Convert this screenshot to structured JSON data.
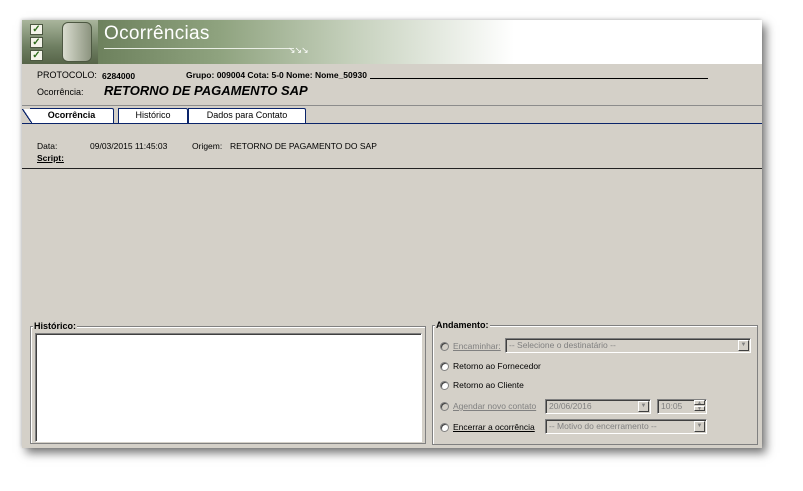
{
  "header": {
    "title": "Ocorrências",
    "arrows": "↘↘↘"
  },
  "protocol": {
    "label": "PROTOCOLO:",
    "value": "6284000",
    "group_info": "Grupo: 009004 Cota: 5-0 Nome: Nome_50930",
    "occurrence_label": "Ocorrência:",
    "occurrence_title": "RETORNO DE PAGAMENTO SAP"
  },
  "tabs": [
    {
      "label": "Ocorrência",
      "active": true
    },
    {
      "label": "Histórico",
      "active": false
    },
    {
      "label": "Dados para Contato",
      "active": false
    }
  ],
  "details": {
    "date_label": "Data:",
    "date_value": "09/03/2015 11:45:03",
    "origin_label": "Origem:",
    "origin_value": "RETORNO DE PAGAMENTO DO SAP",
    "script_label": "Script:"
  },
  "history": {
    "title": "Histórico:"
  },
  "progress": {
    "title": "Andamento:",
    "options": {
      "forward": {
        "label": "Encaminhar:",
        "enabled": false
      },
      "supplier": {
        "label": "Retorno ao Fornecedor",
        "enabled": true
      },
      "client": {
        "label": "Retorno ao Cliente",
        "enabled": true
      },
      "schedule": {
        "label": "Agendar novo contato",
        "enabled": false
      },
      "close": {
        "label": "Encerrar a ocorrência",
        "enabled": true
      }
    },
    "recipient_placeholder": "-- Selecione o destinatário --",
    "schedule_date": "20/06/2016",
    "schedule_time": "10:05",
    "close_reason_placeholder": "-- Motivo do encerramento --"
  },
  "colors": {
    "window_bg": "#d4d0c8",
    "banner_green": "#6c805c",
    "tab_border": "#0a246a"
  }
}
